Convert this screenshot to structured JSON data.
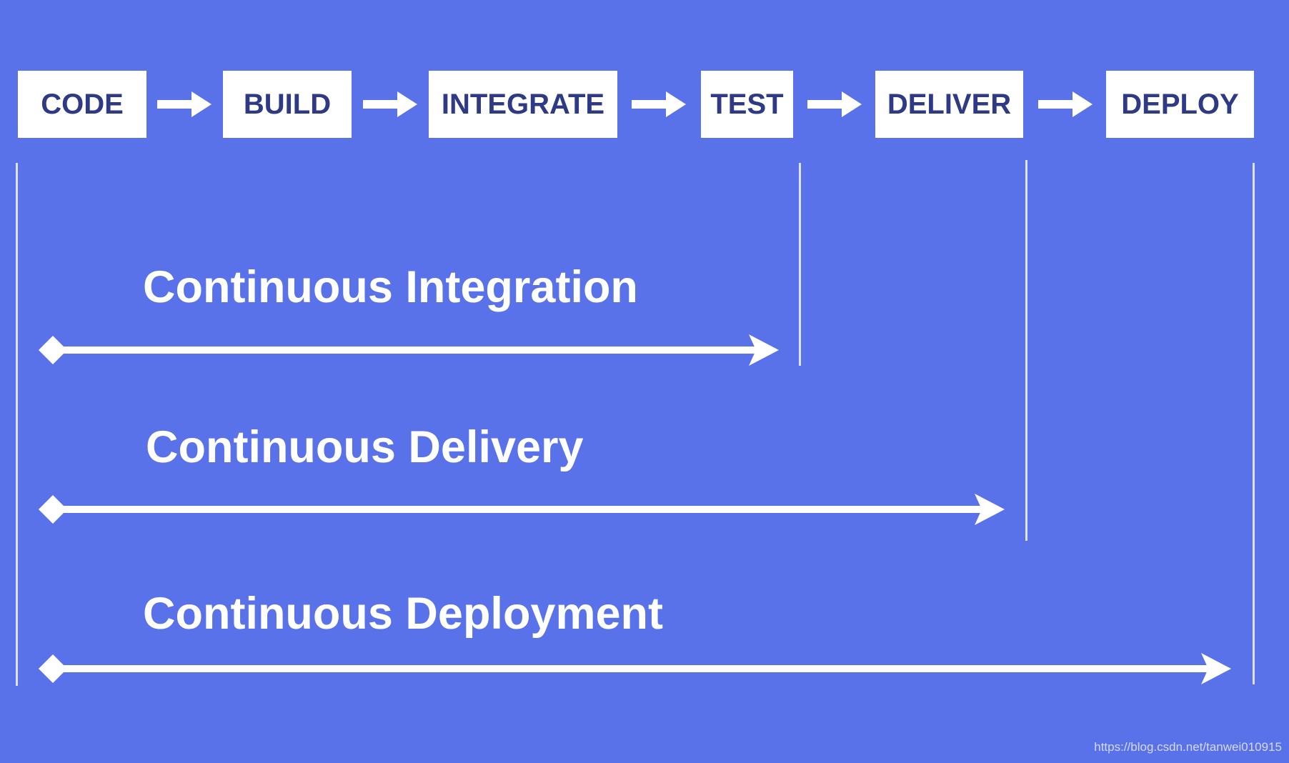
{
  "pipeline": {
    "stages": [
      {
        "label": "CODE"
      },
      {
        "label": "BUILD"
      },
      {
        "label": "INTEGRATE"
      },
      {
        "label": "TEST"
      },
      {
        "label": "DELIVER"
      },
      {
        "label": "DEPLOY"
      }
    ]
  },
  "phases": [
    {
      "label": "Continuous Integration",
      "spans_from": "CODE",
      "spans_to": "TEST"
    },
    {
      "label": "Continuous Delivery",
      "spans_from": "CODE",
      "spans_to": "DELIVER"
    },
    {
      "label": "Continuous Deployment",
      "spans_from": "CODE",
      "spans_to": "DEPLOY"
    }
  ],
  "colors": {
    "background": "#5972EA",
    "box_fill": "#FFFFFF",
    "box_text": "#2E3A86",
    "lines": "#FFFFFF"
  },
  "watermark": "https://blog.csdn.net/tanwei010915"
}
